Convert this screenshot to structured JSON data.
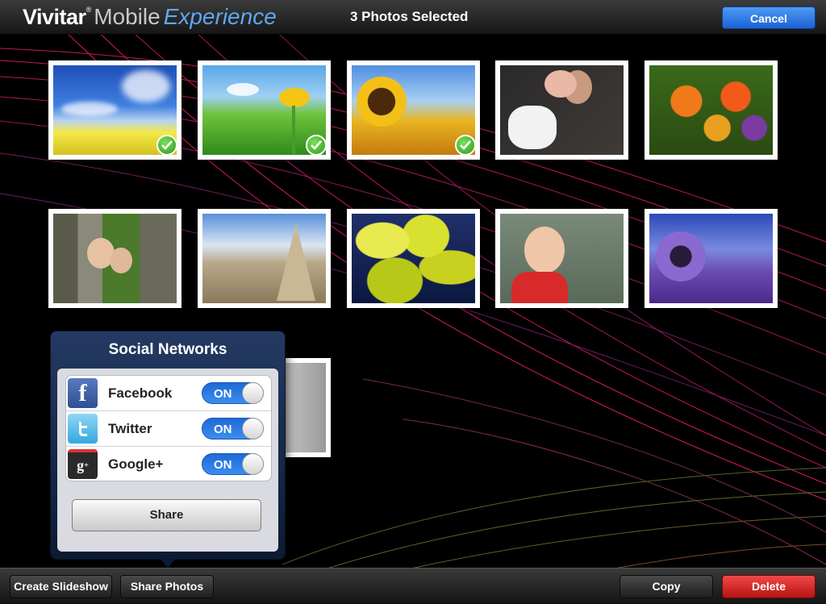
{
  "header": {
    "logo_brand": "Vivitar",
    "logo_reg": "®",
    "logo_mobile": "Mobile",
    "logo_experience": "Experience",
    "title": "3 Photos Selected",
    "cancel_label": "Cancel"
  },
  "photos": [
    {
      "subject": "blue sky over yellow field",
      "selected": true
    },
    {
      "subject": "dandelion in grass",
      "selected": true
    },
    {
      "subject": "sunflower field",
      "selected": true
    },
    {
      "subject": "woman and child with white dog",
      "selected": false
    },
    {
      "subject": "flower bouquet",
      "selected": false
    },
    {
      "subject": "children by tree",
      "selected": false
    },
    {
      "subject": "rock formations",
      "selected": false
    },
    {
      "subject": "yellow balloons",
      "selected": false
    },
    {
      "subject": "girl climbing wall",
      "selected": false
    },
    {
      "subject": "purple flower field",
      "selected": false
    },
    {
      "subject": "gray abstract",
      "selected": false
    }
  ],
  "popover": {
    "title": "Social Networks",
    "networks": [
      {
        "name": "Facebook",
        "icon": "facebook-icon",
        "toggle": "ON"
      },
      {
        "name": "Twitter",
        "icon": "twitter-icon",
        "toggle": "ON"
      },
      {
        "name": "Google+",
        "icon": "google-plus-icon",
        "toggle": "ON"
      }
    ],
    "share_label": "Share"
  },
  "toolbar": {
    "create_slideshow": "Create Slideshow",
    "share_photos": "Share Photos",
    "copy": "Copy",
    "delete": "Delete"
  },
  "colors": {
    "accent": "#2f7fe8",
    "delete": "#d92a2a",
    "toggle_on": "#2a7ae6",
    "background": "#000000"
  }
}
